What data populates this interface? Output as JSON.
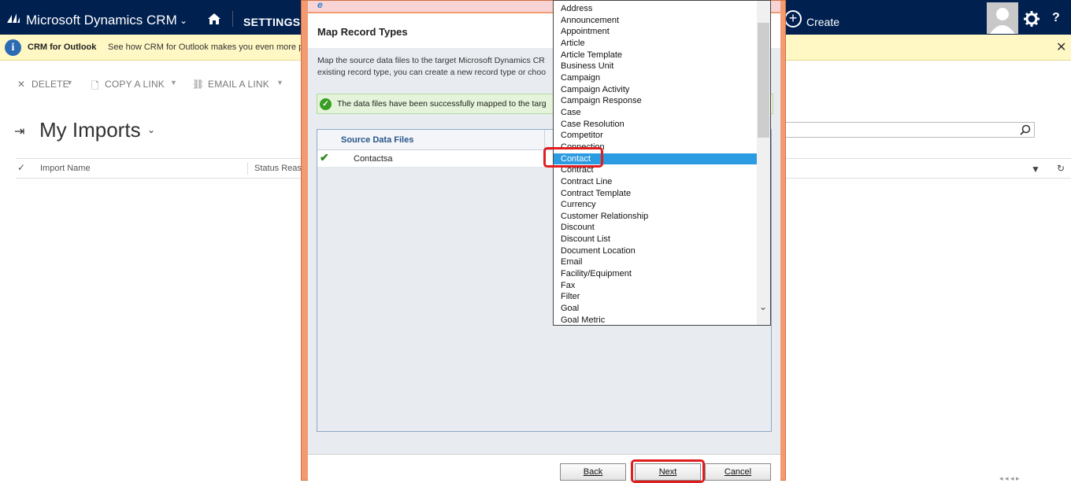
{
  "nav": {
    "app_title": "Microsoft Dynamics CRM",
    "area": "SETTINGS",
    "create_label": "Create",
    "help": "?",
    "bg_color": "#002050"
  },
  "notice": {
    "title": "CRM for Outlook",
    "text": "See how CRM for Outlook makes you even more p",
    "close": "✕"
  },
  "commands": {
    "delete": "DELETE",
    "copy_link": "COPY A LINK",
    "email_link": "EMAIL A LINK"
  },
  "view": {
    "title": "My Imports",
    "search_placeholder": "s"
  },
  "grid": {
    "columns": [
      "Import Name",
      "Status Reaso"
    ]
  },
  "dialog": {
    "title": "Map Record Types",
    "description": "Map the source data files to the target Microsoft Dynamics CR\nexisting record type, you can create a new record type or choo",
    "success_text": "The data files have been successfully mapped to the targ",
    "table_header": "Source Data Files",
    "rows": [
      "Contactsa"
    ],
    "buttons": {
      "back": "Back",
      "next": "Next",
      "cancel": "Cancel"
    }
  },
  "record_types": {
    "selected": "Contact",
    "items": [
      "Address",
      "Announcement",
      "Appointment",
      "Article",
      "Article Template",
      "Business Unit",
      "Campaign",
      "Campaign Activity",
      "Campaign Response",
      "Case",
      "Case Resolution",
      "Competitor",
      "Connection",
      "Contact",
      "Contract",
      "Contract Line",
      "Contract Template",
      "Currency",
      "Customer Relationship",
      "Discount",
      "Discount List",
      "Document Location",
      "Email",
      "Facility/Equipment",
      "Fax",
      "Filter",
      "Goal",
      "Goal Metric"
    ]
  },
  "colors": {
    "selection": "#2b9ce1",
    "highlight": "#e01e1e",
    "dialog_border": "#f29b72"
  }
}
